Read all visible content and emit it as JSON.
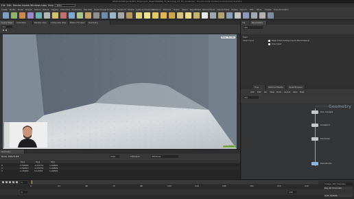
{
  "window": {
    "title": "/RS4ChCh/Projects/SFX_Boxproject_files/HOUDINI_FX_Building_CH_FX_model.hip - Houdini Indie Limited-Commercial 19.0.531"
  },
  "menu": [
    "File",
    "Edit",
    "Render",
    "Assets",
    "Windows",
    "Labs",
    "Help"
  ],
  "shelf": {
    "desktop": "Build",
    "tabs": [
      "Create",
      "Modify",
      "Model",
      "Polygon",
      "Deform",
      "Texture",
      "Rigging",
      "Characters",
      "Constraints",
      "Hair Utils",
      "Guide Process",
      "Terrain FX",
      "Simple FX",
      "Volume",
      "Lights and Cameras",
      "Collisions",
      "Particles",
      "Grains",
      "Vellum",
      "Rigid Bodies",
      "Particle Fluids",
      "Viscous Fluids",
      "Oceans",
      "Pyro FX",
      "FEM",
      "Wires",
      "Crowds",
      "Drive Simulation"
    ]
  },
  "left_panel": {
    "tabs": [
      "Scene View",
      "Animation Editor",
      "Render View",
      "Composite View",
      "Motion FX View",
      "Geometry Spreadsheet"
    ],
    "path": "obj",
    "view_label_1": "Persp",
    "view_label_2": "No cam",
    "status": "Indie Edition"
  },
  "spreadsheet": {
    "tabs": [
      "Geometry Spreadsheet"
    ],
    "node": "Node: FRACTURE",
    "view": "View",
    "intrinsics": "Intrinsics",
    "attribute": "Attribute",
    "columns": [
      "",
      "P[x]",
      "P[y]",
      "P[z]"
    ],
    "rows": [
      [
        "0",
        "-1.50000",
        "-0.03731",
        "1.94829"
      ],
      [
        "1",
        "-1.50013",
        "-0.03731",
        "1.44829"
      ],
      [
        "2",
        "-1.45000",
        "0.12345",
        "1.94829"
      ]
    ]
  },
  "parameters": {
    "tabs": [
      "obj",
      "Parameters"
    ],
    "node_name": "obj",
    "label": "Geometry",
    "row1": "Main",
    "row2": "Keep Input",
    "checkbox1": "Keep Intersecting Input (Parameters)",
    "checkbox2": "Use Input"
  },
  "network": {
    "tabs": [
      "Tree View",
      "Material Palette",
      "Asset Browser"
    ],
    "menu": [
      "Add",
      "Edit",
      "Go",
      "View",
      "Tools",
      "Layout",
      "Labs",
      "Help"
    ],
    "path": "obj",
    "context_label": "Geometry",
    "edition_label": "Indie Edition",
    "nodes": [
      "box_merge1",
      "boolean1",
      "fracture1",
      "transform1"
    ]
  },
  "timeline": {
    "frame": "1",
    "ticks": [
      "0",
      "24",
      "48",
      "72",
      "96",
      "120",
      "144",
      "168",
      "192",
      "216",
      "240"
    ],
    "start": "1",
    "end": "240",
    "key_label": "0 keys, 0/0 channels",
    "key_all": "Key All Channels",
    "auto_update": "Auto Update"
  },
  "colors": {
    "accent": "#f2a933",
    "viewport_bg": "#a9b9c2",
    "wall": "#67727e",
    "floor": "#cfd3d7"
  }
}
